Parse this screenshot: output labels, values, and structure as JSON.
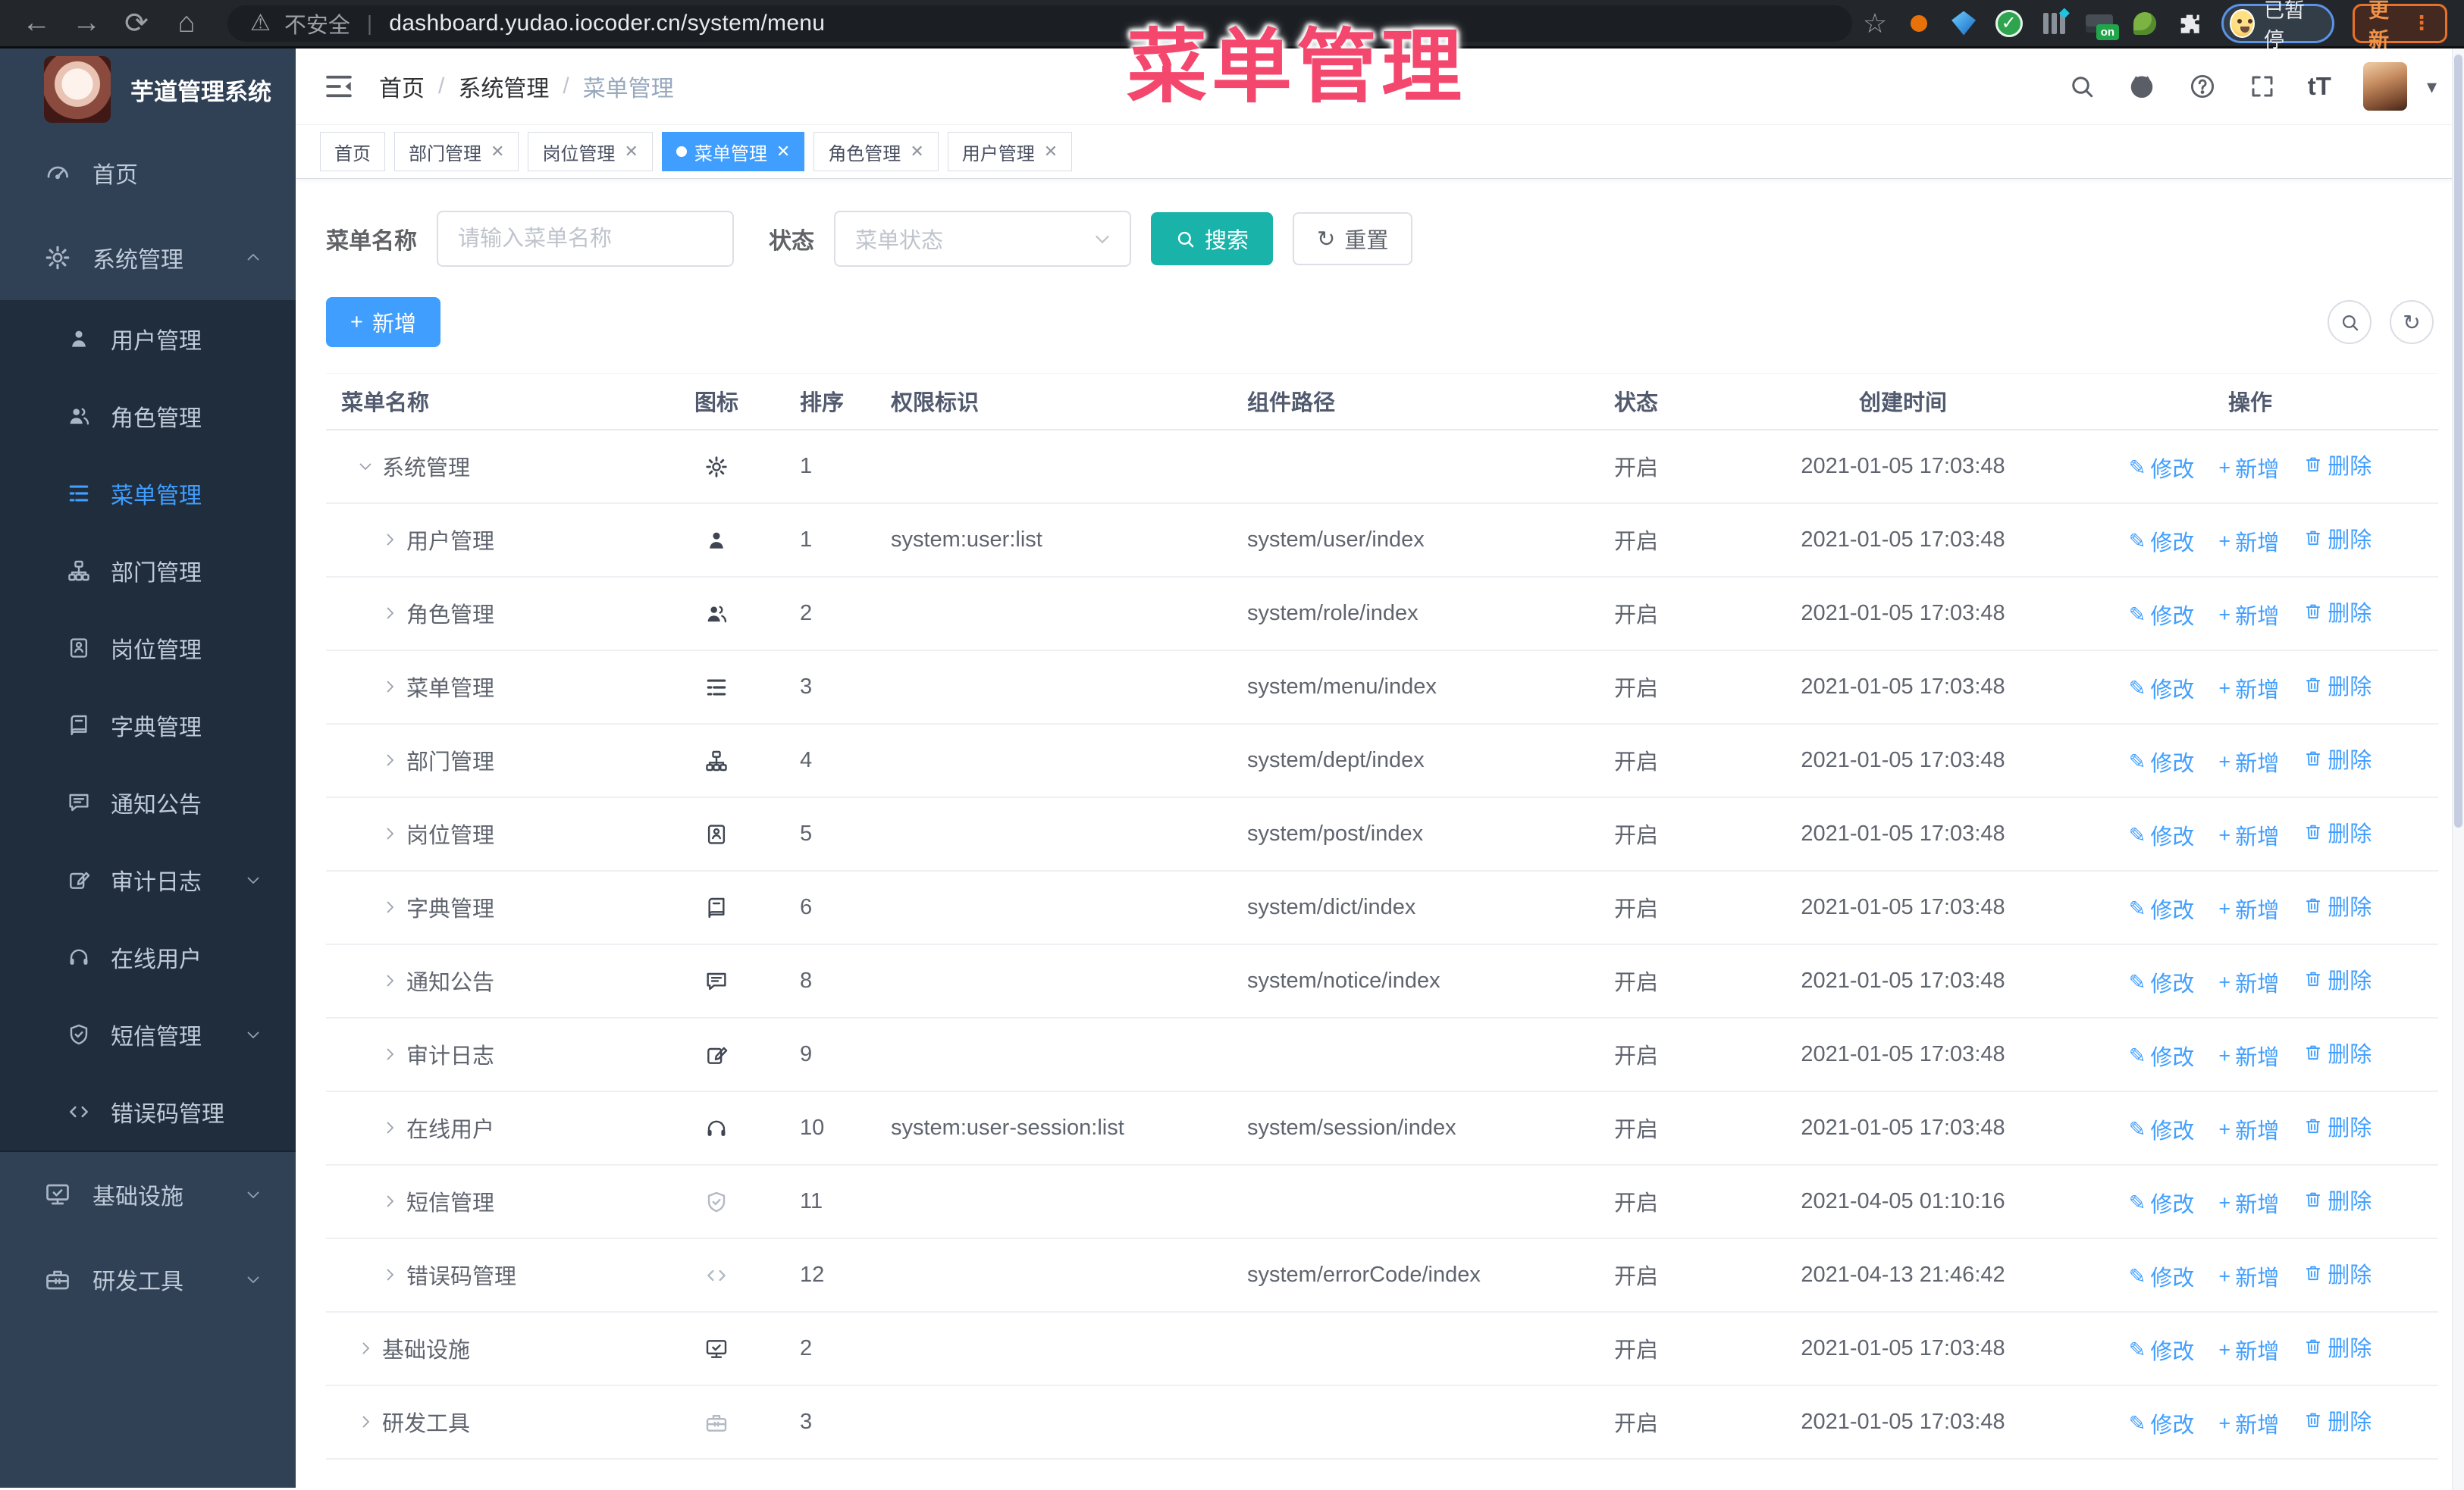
{
  "browser": {
    "security_label": "不安全",
    "url": "dashboard.yudao.iocoder.cn/system/menu",
    "extension_badge": "on",
    "profile_label": "已暂停",
    "update_label": "更新"
  },
  "overlay": {
    "text": "菜单管理"
  },
  "sidebar": {
    "title": "芋道管理系统",
    "items": [
      {
        "label": "首页",
        "icon": "gauge-icon",
        "level": 1
      },
      {
        "label": "系统管理",
        "icon": "gear-icon",
        "level": 1,
        "arrow": "up"
      },
      {
        "label": "用户管理",
        "icon": "user-icon",
        "level": 2
      },
      {
        "label": "角色管理",
        "icon": "users-icon",
        "level": 2
      },
      {
        "label": "菜单管理",
        "icon": "menu-icon",
        "level": 2,
        "active": true
      },
      {
        "label": "部门管理",
        "icon": "tree-icon",
        "level": 2
      },
      {
        "label": "岗位管理",
        "icon": "badge-icon",
        "level": 2
      },
      {
        "label": "字典管理",
        "icon": "book-icon",
        "level": 2
      },
      {
        "label": "通知公告",
        "icon": "message-icon",
        "level": 2
      },
      {
        "label": "审计日志",
        "icon": "edit-icon",
        "level": 2,
        "arrow": "down"
      },
      {
        "label": "在线用户",
        "icon": "headset-icon",
        "level": 2
      },
      {
        "label": "短信管理",
        "icon": "shield-icon",
        "level": 2,
        "arrow": "down"
      },
      {
        "label": "错误码管理",
        "icon": "code-icon",
        "level": 2
      },
      {
        "label": "基础设施",
        "icon": "monitor-icon",
        "level": 1,
        "arrow": "down"
      },
      {
        "label": "研发工具",
        "icon": "briefcase-icon",
        "level": 1,
        "arrow": "down"
      }
    ]
  },
  "navbar": {
    "breadcrumb": [
      "首页",
      "系统管理",
      "菜单管理"
    ],
    "separator": "/",
    "font_size_glyph": "tT"
  },
  "tabs": [
    {
      "label": "首页",
      "closable": false,
      "active": false
    },
    {
      "label": "部门管理",
      "closable": true,
      "active": false
    },
    {
      "label": "岗位管理",
      "closable": true,
      "active": false
    },
    {
      "label": "菜单管理",
      "closable": true,
      "active": true
    },
    {
      "label": "角色管理",
      "closable": true,
      "active": false
    },
    {
      "label": "用户管理",
      "closable": true,
      "active": false
    }
  ],
  "filters": {
    "name_label": "菜单名称",
    "name_placeholder": "请输入菜单名称",
    "status_label": "状态",
    "status_placeholder": "菜单状态",
    "search_label": "搜索",
    "reset_label": "重置",
    "add_label": "新增"
  },
  "table": {
    "columns": [
      "菜单名称",
      "图标",
      "排序",
      "权限标识",
      "组件路径",
      "状态",
      "创建时间",
      "操作"
    ],
    "actions": {
      "edit": "修改",
      "add": "新增",
      "delete": "删除"
    },
    "rows": [
      {
        "name": "系统管理",
        "icon": "gear-icon",
        "level": 1,
        "expanded": true,
        "sort": "1",
        "perm": "",
        "path": "",
        "status": "开启",
        "created": "2021-01-05 17:03:48"
      },
      {
        "name": "用户管理",
        "icon": "user-icon",
        "level": 2,
        "sort": "1",
        "perm": "system:user:list",
        "path": "system/user/index",
        "status": "开启",
        "created": "2021-01-05 17:03:48"
      },
      {
        "name": "角色管理",
        "icon": "users-icon",
        "level": 2,
        "sort": "2",
        "perm": "",
        "path": "system/role/index",
        "status": "开启",
        "created": "2021-01-05 17:03:48"
      },
      {
        "name": "菜单管理",
        "icon": "menu-icon",
        "level": 2,
        "sort": "3",
        "perm": "",
        "path": "system/menu/index",
        "status": "开启",
        "created": "2021-01-05 17:03:48"
      },
      {
        "name": "部门管理",
        "icon": "tree-icon",
        "level": 2,
        "sort": "4",
        "perm": "",
        "path": "system/dept/index",
        "status": "开启",
        "created": "2021-01-05 17:03:48"
      },
      {
        "name": "岗位管理",
        "icon": "badge-icon",
        "level": 2,
        "sort": "5",
        "perm": "",
        "path": "system/post/index",
        "status": "开启",
        "created": "2021-01-05 17:03:48"
      },
      {
        "name": "字典管理",
        "icon": "book-icon",
        "level": 2,
        "sort": "6",
        "perm": "",
        "path": "system/dict/index",
        "status": "开启",
        "created": "2021-01-05 17:03:48"
      },
      {
        "name": "通知公告",
        "icon": "message-icon",
        "level": 2,
        "sort": "8",
        "perm": "",
        "path": "system/notice/index",
        "status": "开启",
        "created": "2021-01-05 17:03:48"
      },
      {
        "name": "审计日志",
        "icon": "edit-icon",
        "level": 2,
        "sort": "9",
        "perm": "",
        "path": "",
        "status": "开启",
        "created": "2021-01-05 17:03:48"
      },
      {
        "name": "在线用户",
        "icon": "headset-icon",
        "level": 2,
        "sort": "10",
        "perm": "system:user-session:list",
        "path": "system/session/index",
        "status": "开启",
        "created": "2021-01-05 17:03:48"
      },
      {
        "name": "短信管理",
        "icon": "shield-icon",
        "level": 2,
        "tone": "light",
        "sort": "11",
        "perm": "",
        "path": "",
        "status": "开启",
        "created": "2021-04-05 01:10:16"
      },
      {
        "name": "错误码管理",
        "icon": "code-icon",
        "level": 2,
        "tone": "light",
        "sort": "12",
        "perm": "",
        "path": "system/errorCode/index",
        "status": "开启",
        "created": "2021-04-13 21:46:42"
      },
      {
        "name": "基础设施",
        "icon": "monitor-icon",
        "level": 1,
        "sort": "2",
        "perm": "",
        "path": "",
        "status": "开启",
        "created": "2021-01-05 17:03:48"
      },
      {
        "name": "研发工具",
        "icon": "briefcase-icon",
        "level": 1,
        "tone": "light",
        "sort": "3",
        "perm": "",
        "path": "",
        "status": "开启",
        "created": "2021-01-05 17:03:48"
      }
    ]
  },
  "colors": {
    "primary": "#409eff",
    "search_teal": "#1ab3a9",
    "overlay_red": "#f4476e",
    "sidebar_bg": "#304156",
    "submenu_bg": "#1f2d3d",
    "sidebar_text": "#bfcbd9",
    "chrome_bg": "#23272c"
  }
}
